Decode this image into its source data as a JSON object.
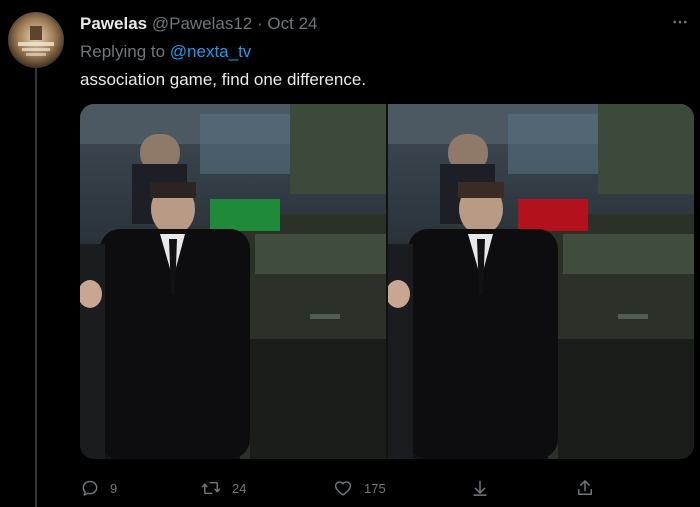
{
  "tweet": {
    "display_name": "Pawelas",
    "handle": "@Pawelas12",
    "separator": "·",
    "date": "Oct 24",
    "replying_prefix": "Replying to ",
    "replying_to": "@nexta_tv",
    "text": "association game, find one difference."
  },
  "actions": {
    "reply_count": "9",
    "retweet_count": "24",
    "like_count": "175"
  },
  "icons": {
    "more": "more-icon",
    "reply": "reply-icon",
    "retweet": "retweet-icon",
    "like": "heart-icon",
    "share": "share-icon",
    "upload": "upload-icon"
  },
  "colors": {
    "background": "#000000",
    "text": "#e7e9ea",
    "muted": "#71767b",
    "link": "#1d9bf0",
    "left_panel_accent": "#1f8a3a",
    "right_panel_accent": "#b3121c"
  }
}
